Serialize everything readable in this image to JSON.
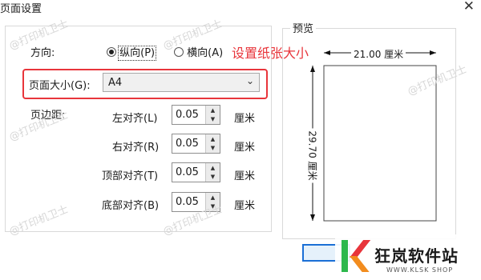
{
  "dialog": {
    "title": "页面设置",
    "close_glyph": "✕"
  },
  "orientation": {
    "label": "方向:",
    "portrait": "纵向(P)",
    "landscape": "横向(A)",
    "selected": "portrait"
  },
  "annotation": {
    "text": "设置纸张大小",
    "color": "#e8353b"
  },
  "page_size": {
    "label": "页面大小(G):",
    "value": "A4"
  },
  "margins": {
    "label": "页边距:",
    "rows": [
      {
        "label": "左对齐(L)",
        "value": "0.05",
        "unit": "厘米"
      },
      {
        "label": "右对齐(R)",
        "value": "0.05",
        "unit": "厘米"
      },
      {
        "label": "顶部对齐(T)",
        "value": "0.05",
        "unit": "厘米"
      },
      {
        "label": "底部对齐(B)",
        "value": "0.05",
        "unit": "厘米"
      }
    ]
  },
  "preview": {
    "label": "预览",
    "width_text": "21.00 厘米",
    "height_text": "29.70 厘米"
  },
  "watermarks": {
    "text": "@打印机卫士"
  },
  "logo": {
    "name": "狂岚软件站",
    "url": "WWW.KLSK SHOP",
    "k_color": "#e8353b"
  }
}
